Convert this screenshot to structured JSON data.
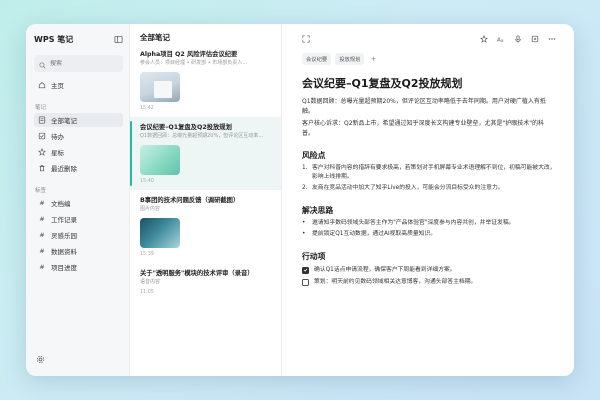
{
  "app": {
    "title": "WPS 笔记"
  },
  "search": {
    "placeholder": "搜索"
  },
  "nav": {
    "home": "主页",
    "section_notes": "笔记",
    "items": [
      "全部笔记",
      "待办",
      "星标",
      "最近删除"
    ],
    "section_tags": "标签",
    "tags": [
      "文档编",
      "工作记录",
      "灵感乐园",
      "数据资料",
      "项目进度"
    ]
  },
  "list": {
    "header": "全部笔记",
    "cards": [
      {
        "title": "Alpha项目 Q2 风险评估会议纪要",
        "snippet": "参会人员：项目经理 • 研发部 • 市场部负责人…",
        "date": "15:42"
      },
      {
        "title": "会议纪要–Q1复盘及Q2投放规划",
        "snippet": "Q1数据回顾：总曝光量超预期20%，但评论区互动率…",
        "date": "15:40"
      },
      {
        "title": "B事团的技术问题反馈（调研截图）",
        "snippet": "图片内容",
        "date": "15:39"
      },
      {
        "title": "关于\"透明服务\"模块的技术评审（录音）",
        "snippet": "语音内容",
        "date": "11:05"
      }
    ]
  },
  "note": {
    "tags": [
      "会议纪要",
      "投放规划"
    ],
    "add_tag": "+",
    "title": "会议纪要–Q1复盘及Q2投放规划",
    "intro": [
      "Q1数据回顾：总曝光量超预期20%，但评论区互动率略低于去年同期。用户对硬广植入有抵触。",
      "客户核心诉求：Q2新品上市，希望通过知乎深度长文构建专业壁垒，尤其是\"护眼技术\"的科普。"
    ],
    "risk_heading": "风险点",
    "risks": [
      "客户对科普内容的措辞有要求极高，若策划对手机屏幕专业术语理解不到位，初稿可能被大改，影响上线排期。",
      "友商在竞品活动中加大了知乎Live的投入，可能会分流目标受众的注意力。"
    ],
    "solution_heading": "解决思路",
    "solutions": [
      "邀请知乎数码领域头部答主作为\"产品体验官\"深度参与内容共创，并举证发稿。",
      "提前锁定Q1互动数据，通过AI视取高质量知识。"
    ],
    "action_heading": "行动项",
    "actions": [
      {
        "text": "确认Q1话点申请流程，确保客户下周能看到详细方案。",
        "done": true
      },
      {
        "text": "策划：明天前约见数码领域相关达意博客，沟通头部答主档期。",
        "done": false
      }
    ]
  }
}
